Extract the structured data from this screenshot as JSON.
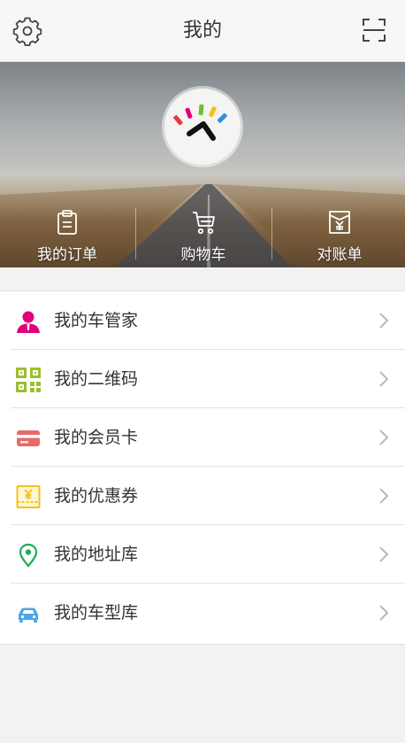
{
  "header": {
    "title": "我的",
    "settings_icon": "gear-icon",
    "scan_icon": "scan-icon"
  },
  "hero": {
    "logo_icon": "brand-logo",
    "shortcuts": [
      {
        "label": "我的订单",
        "icon": "order-clipboard-icon"
      },
      {
        "label": "购物车",
        "icon": "shopping-cart-icon"
      },
      {
        "label": "对账单",
        "icon": "statement-icon"
      }
    ]
  },
  "menu": {
    "items": [
      {
        "label": "我的车管家",
        "icon": "person-icon",
        "color": "#e2007a"
      },
      {
        "label": "我的二维码",
        "icon": "qr-code-icon",
        "color": "#9bbf2a"
      },
      {
        "label": "我的会员卡",
        "icon": "card-icon",
        "color": "#e86a6a"
      },
      {
        "label": "我的优惠券",
        "icon": "coupon-icon",
        "color": "#f2c11c"
      },
      {
        "label": "我的地址库",
        "icon": "location-pin-icon",
        "color": "#27a95a"
      },
      {
        "label": "我的车型库",
        "icon": "car-icon",
        "color": "#4aa6e6"
      }
    ]
  }
}
